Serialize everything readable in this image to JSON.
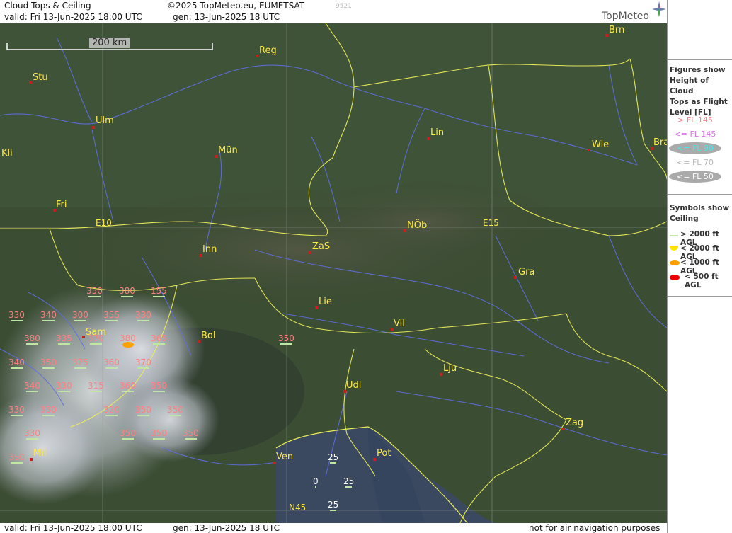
{
  "header": {
    "title": "Cloud Tops & Ceiling",
    "copyright": "©2025 TopMeteo.eu, EUMETSAT",
    "code": "9521",
    "valid": "valid:  Fri  13-Jun-2025  18:00 UTC",
    "gen": "gen: 13-Jun-2025 18 UTC",
    "logo": "TopMeteo"
  },
  "footer": {
    "valid": "valid:  Fri  13-Jun-2025  18:00 UTC",
    "gen": "gen: 13-Jun-2025 18 UTC",
    "notice": "not for air navigation purposes"
  },
  "scale": {
    "label": "200 km"
  },
  "cities": [
    {
      "name": "Brn"
    },
    {
      "name": "Reg"
    },
    {
      "name": "Stu"
    },
    {
      "name": "Ulm"
    },
    {
      "name": "Lin"
    },
    {
      "name": "Wie"
    },
    {
      "name": "Bra"
    },
    {
      "name": "Kli"
    },
    {
      "name": "Mün"
    },
    {
      "name": "Fri"
    },
    {
      "name": "NÖb"
    },
    {
      "name": "Inn"
    },
    {
      "name": "ZaS"
    },
    {
      "name": "Gra"
    },
    {
      "name": "Lie"
    },
    {
      "name": "Vil"
    },
    {
      "name": "Sam"
    },
    {
      "name": "Bol"
    },
    {
      "name": "Lju"
    },
    {
      "name": "Udi"
    },
    {
      "name": "Zag"
    },
    {
      "name": "Pot"
    },
    {
      "name": "Ven"
    },
    {
      "name": "Mil"
    }
  ],
  "geo_labels": [
    "E10",
    "E15",
    "N45"
  ],
  "cloud_tops": [
    {
      "v": "350"
    },
    {
      "v": "380"
    },
    {
      "v": "155"
    },
    {
      "v": "330"
    },
    {
      "v": "340"
    },
    {
      "v": "300"
    },
    {
      "v": "355"
    },
    {
      "v": "330"
    },
    {
      "v": "380"
    },
    {
      "v": "335"
    },
    {
      "v": "370"
    },
    {
      "v": "380"
    },
    {
      "v": "365"
    },
    {
      "v": "350"
    },
    {
      "v": "340"
    },
    {
      "v": "350"
    },
    {
      "v": "375"
    },
    {
      "v": "360"
    },
    {
      "v": "370"
    },
    {
      "v": "340"
    },
    {
      "v": "330"
    },
    {
      "v": "315"
    },
    {
      "v": "360"
    },
    {
      "v": "350"
    },
    {
      "v": "330"
    },
    {
      "v": "330"
    },
    {
      "v": "320"
    },
    {
      "v": "350"
    },
    {
      "v": "350"
    },
    {
      "v": "330"
    },
    {
      "v": "350"
    },
    {
      "v": "350"
    },
    {
      "v": "350"
    },
    {
      "v": "350"
    },
    {
      "v": "25"
    },
    {
      "v": "0"
    },
    {
      "v": "25"
    },
    {
      "v": "25"
    }
  ],
  "legend": {
    "fl_title": [
      "Figures show",
      "Height of Cloud",
      "Tops as Flight",
      "Level  [FL]"
    ],
    "fl_items": [
      {
        "label": "> FL 145",
        "color": "#ff8080"
      },
      {
        "label": "<= FL 145",
        "color": "#e06cf0"
      },
      {
        "label": "<= FL 90",
        "color": "#48e8f0"
      },
      {
        "label": "<= FL 70",
        "color": "#b8b8b8"
      },
      {
        "label": "<= FL 50",
        "color": "#ffffff"
      }
    ],
    "sym_title": [
      "Symbols show",
      "Ceiling"
    ],
    "sym_items": [
      {
        "label": "> 2000 ft AGL",
        "color": "#bfe6a2"
      },
      {
        "label": "< 2000 ft AGL",
        "color": "#ffe600"
      },
      {
        "label": "< 1000 ft AGL",
        "color": "#ffa000"
      },
      {
        "label": "< 500 ft AGL",
        "color": "#ee0000"
      }
    ]
  }
}
